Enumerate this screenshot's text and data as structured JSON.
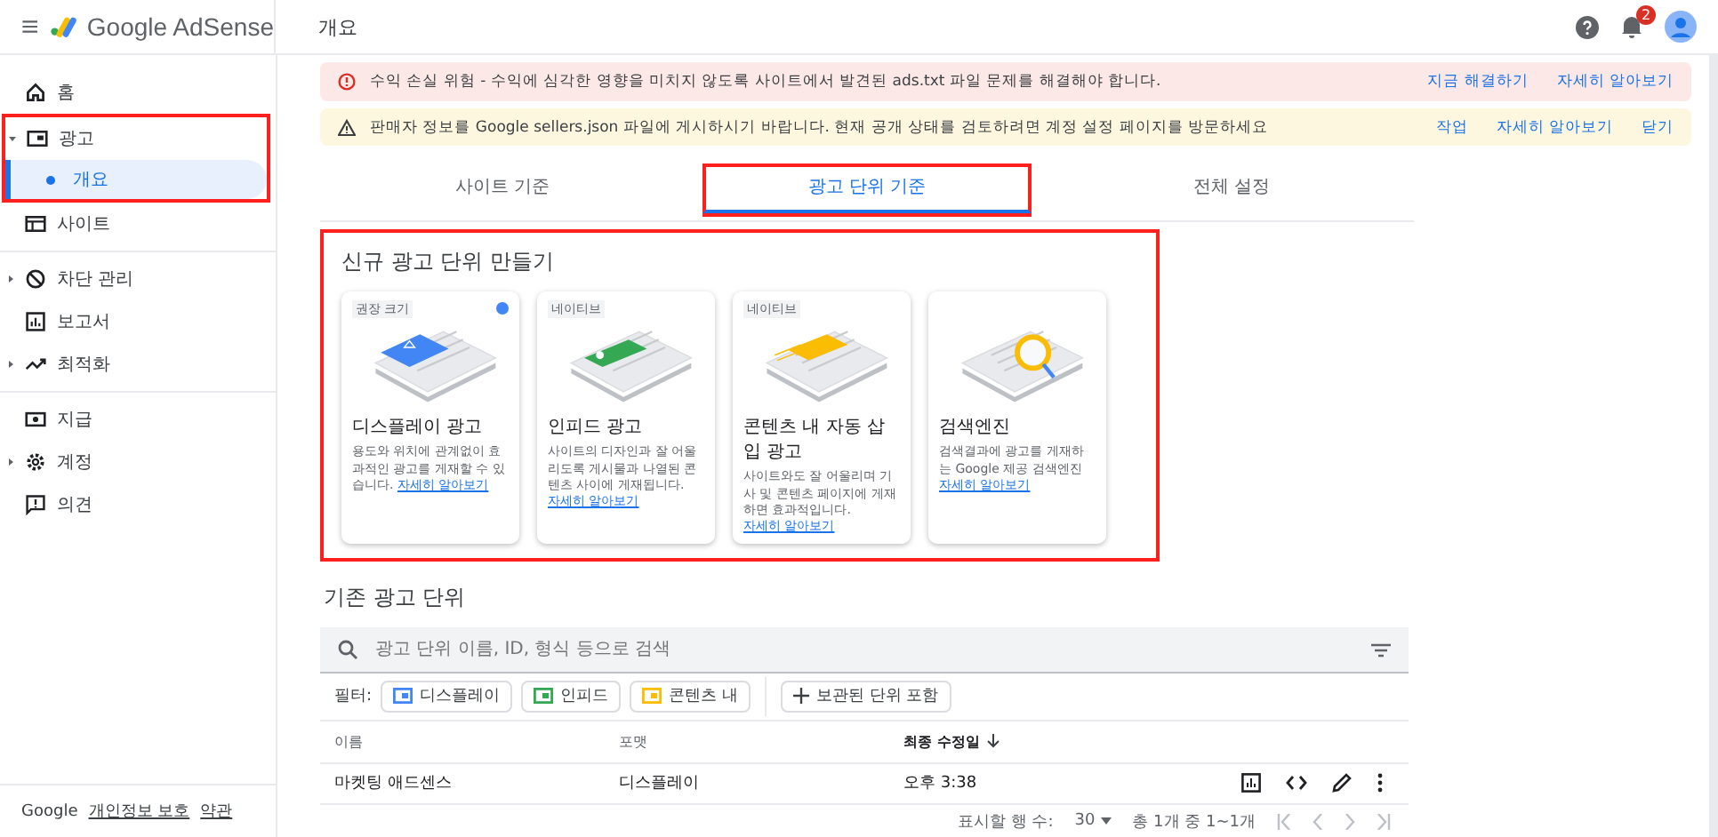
{
  "header": {
    "app_name": "Google AdSense",
    "page_title": "개요",
    "notification_count": "2"
  },
  "sidebar": {
    "groups": [
      [
        {
          "kind": "home",
          "label": "홈"
        },
        {
          "kind": "ads",
          "label": "광고",
          "expanded": true,
          "highlighted": true,
          "children": [
            {
              "label": "개요",
              "selected": true
            }
          ]
        },
        {
          "kind": "sites",
          "label": "사이트"
        }
      ],
      [
        {
          "kind": "block",
          "label": "차단 관리",
          "expanded": false
        },
        {
          "kind": "report",
          "label": "보고서"
        },
        {
          "kind": "trend",
          "label": "최적화",
          "expanded": false
        }
      ],
      [
        {
          "kind": "payment",
          "label": "지급"
        },
        {
          "kind": "gear",
          "label": "계정",
          "expanded": false
        },
        {
          "kind": "feedback",
          "label": "의견"
        }
      ]
    ],
    "footer": {
      "brand": "Google",
      "links": [
        "개인정보 보호",
        "약관"
      ]
    }
  },
  "alerts": [
    {
      "kind": "error",
      "text": "수익 손실 위험 - 수익에 심각한 영향을 미치지 않도록 사이트에서 발견된 ads.txt 파일 문제를 해결해야 합니다.",
      "actions": [
        "지금 해결하기",
        "자세히 알아보기"
      ]
    },
    {
      "kind": "warning",
      "text": "판매자 정보를 Google sellers.json 파일에 게시하시기 바랍니다. 현재 공개 상태를 검토하려면 계정 설정 페이지를 방문하세요",
      "actions": [
        "작업",
        "자세히 알아보기",
        "닫기"
      ]
    }
  ],
  "tabs": [
    {
      "label": "사이트 기준",
      "selected": false,
      "highlighted": false
    },
    {
      "label": "광고 단위 기준",
      "selected": true,
      "highlighted": true
    },
    {
      "label": "전체 설정",
      "selected": false,
      "highlighted": false
    }
  ],
  "create": {
    "title": "신규 광고 단위 만들기",
    "highlighted": true,
    "cards": [
      {
        "kind": "display",
        "tag": "권장 크기",
        "recommended": true,
        "color": "#4285f4",
        "title": "디스플레이 광고",
        "description": "용도와 위치에 관계없이 효과적인 광고를 게재할 수 있습니다.",
        "link": "자세히 알아보기"
      },
      {
        "kind": "infeed",
        "tag": "네이티브",
        "recommended": false,
        "color": "#34a853",
        "title": "인피드 광고",
        "description": "사이트의 디자인과 잘 어울리도록 게시물과 나열된 콘텐츠 사이에 게재됩니다.",
        "link": "자세히 알아보기"
      },
      {
        "kind": "inarticle",
        "tag": "네이티브",
        "recommended": false,
        "color": "#fbbc04",
        "title": "콘텐츠 내 자동 삽입 광고",
        "description": "사이트와도 잘 어울리며 기사 및 콘텐츠 페이지에 게재하면 효과적입니다.",
        "link": "자세히 알아보기"
      },
      {
        "kind": "search",
        "recommended": false,
        "color": "#fbbc04",
        "title": "검색엔진",
        "description": "검색결과에 광고를 게재하는 Google 제공 검색엔진",
        "link": "자세히 알아보기"
      }
    ]
  },
  "existing": {
    "title": "기존 광고 단위",
    "search": {
      "placeholder": "광고 단위 이름, ID, 형식 등으로 검색"
    },
    "filter_label": "필터:",
    "filters": [
      {
        "label": "디스플레이",
        "color": "#4285f4"
      },
      {
        "label": "인피드",
        "color": "#34a853"
      },
      {
        "label": "콘텐츠 내",
        "color": "#fbbc04"
      }
    ],
    "archived_chip": "보관된 단위 포함",
    "table": {
      "columns": [
        {
          "label": "이름",
          "sorted": false
        },
        {
          "label": "포맷",
          "sorted": false
        },
        {
          "label": "최종 수정일",
          "sorted": true
        }
      ],
      "rows": [
        [
          "마켓팅 애드센스",
          "디스플레이",
          "오후 3:38"
        ]
      ]
    },
    "pagination": {
      "rows_label": "표시할 행 수:",
      "rows_value": "30",
      "range": "총 1개 중 1~1개"
    }
  }
}
